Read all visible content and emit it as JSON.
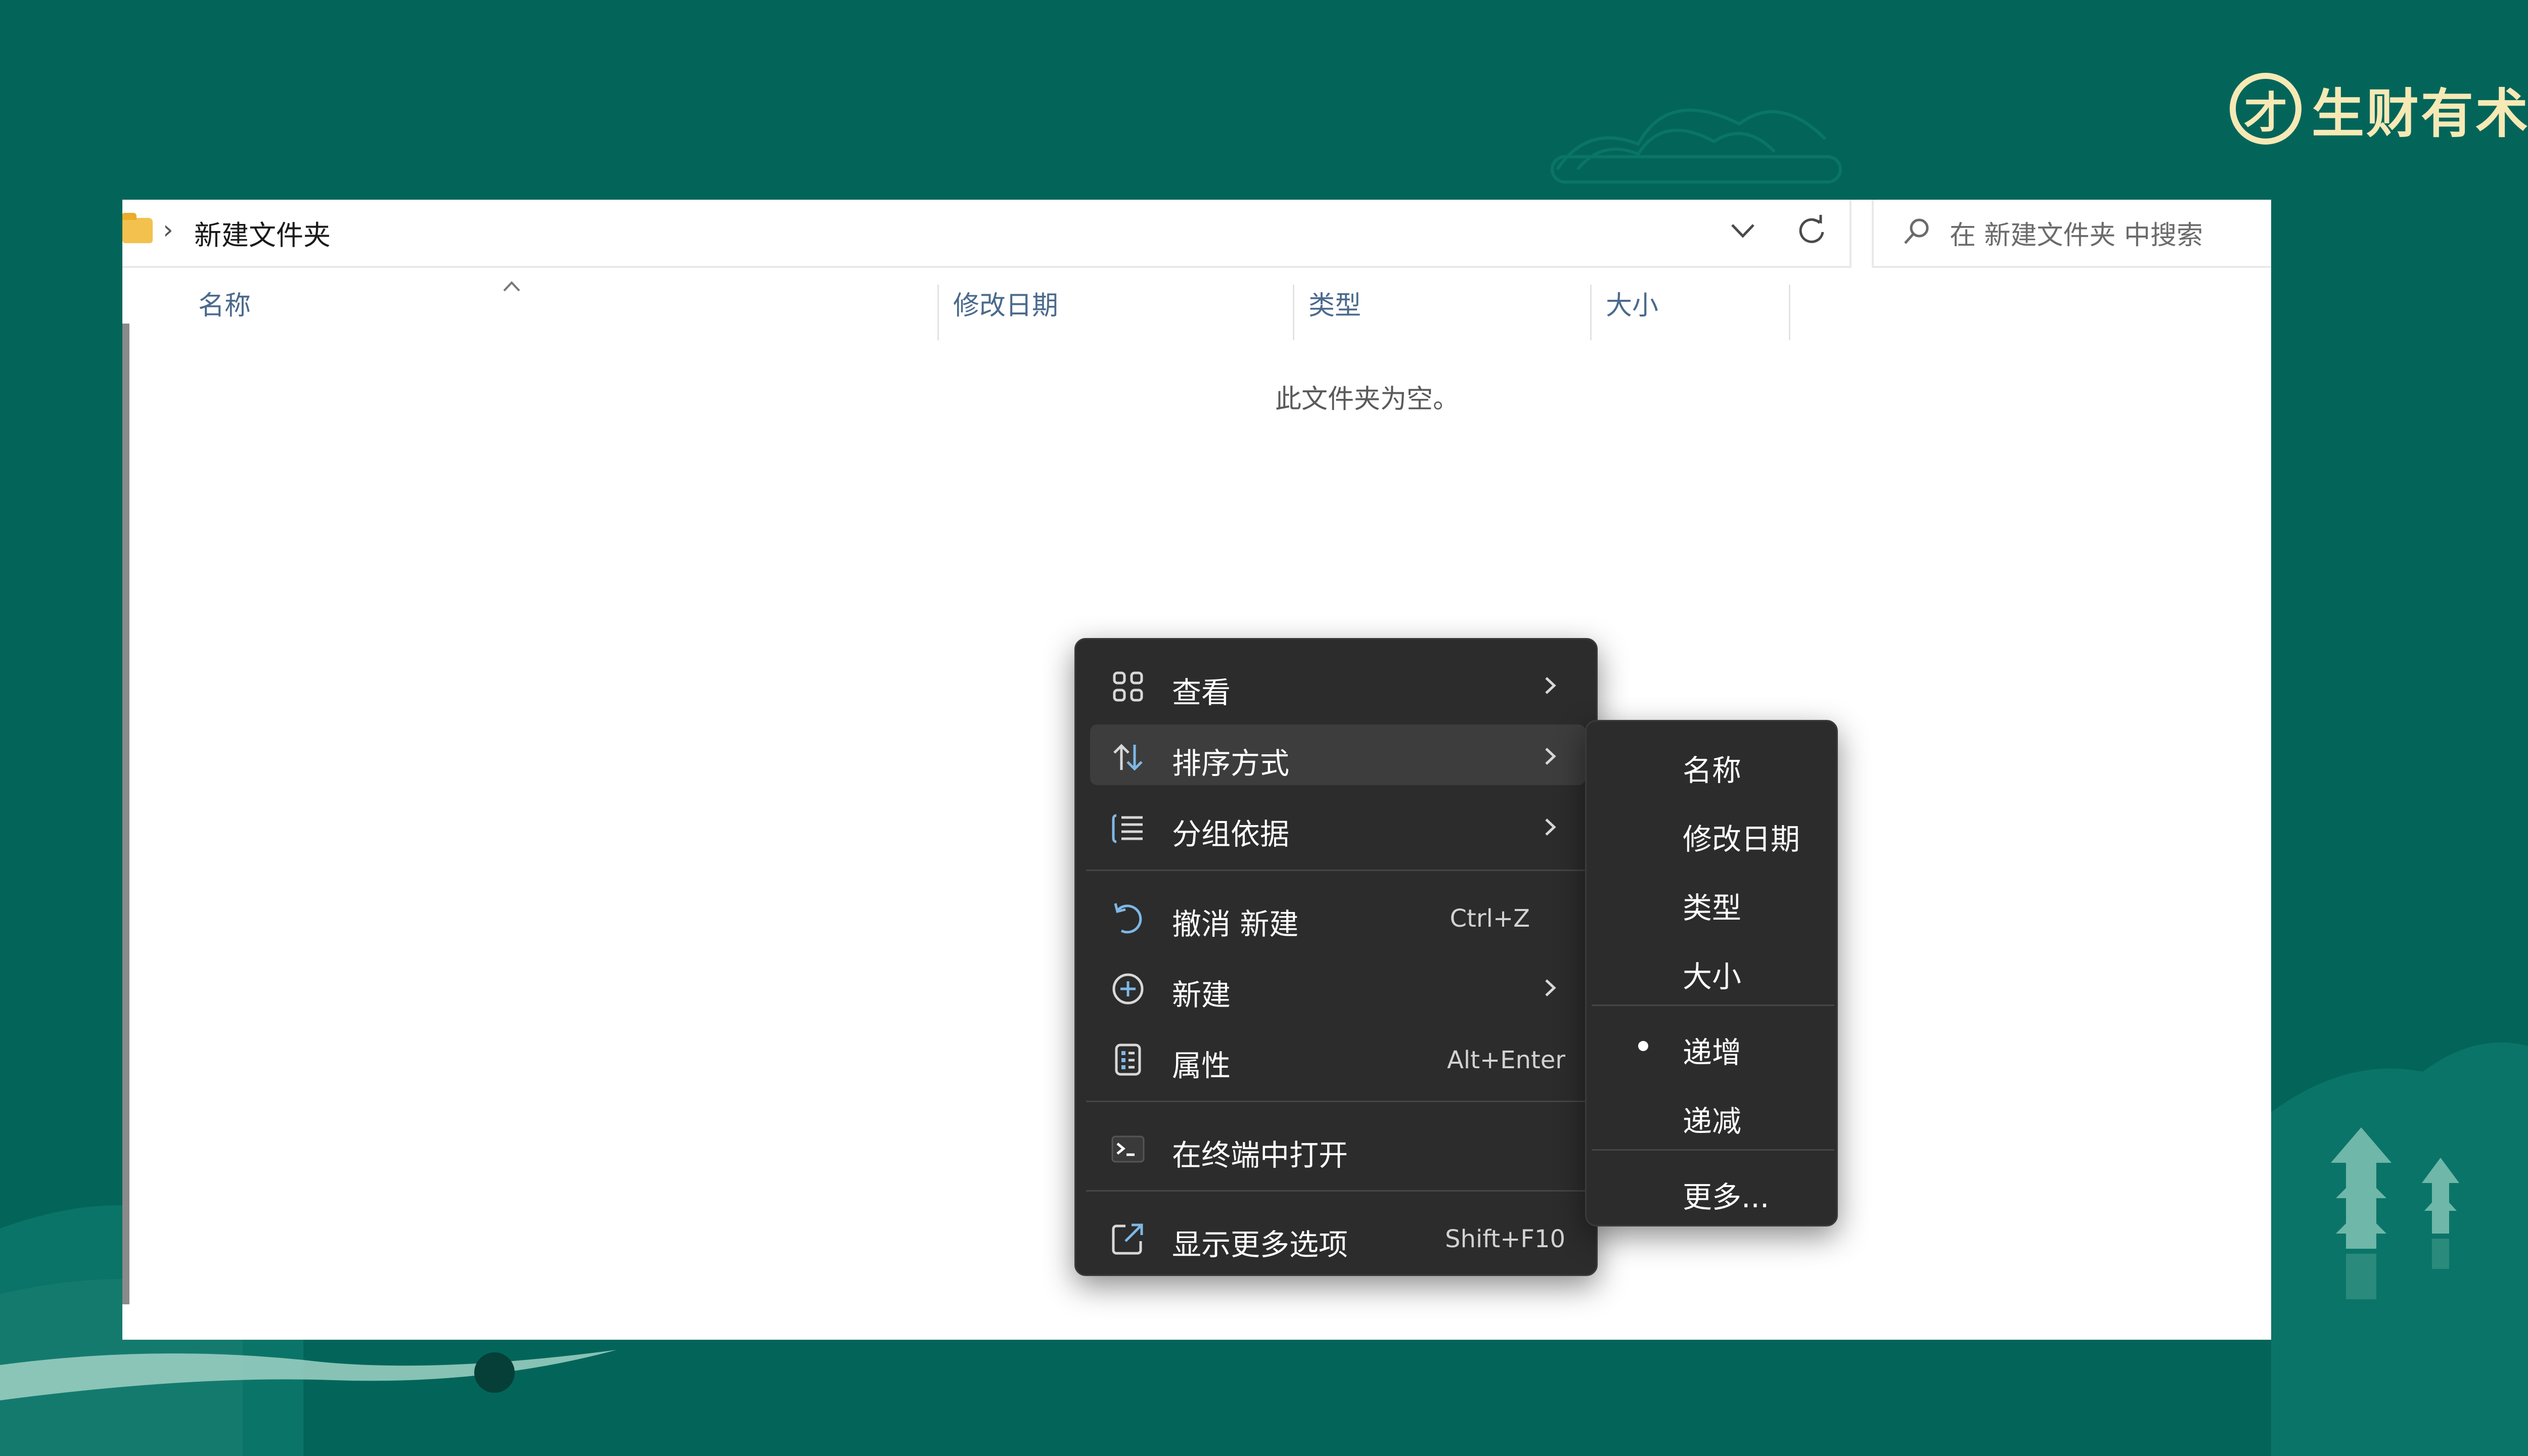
{
  "brand": {
    "mark": "才",
    "name": "生财有术"
  },
  "window": {
    "address": {
      "separator": "›",
      "path": "新建文件夹"
    },
    "search": {
      "placeholder": "在 新建文件夹 中搜索"
    },
    "columns": [
      "名称",
      "修改日期",
      "类型",
      "大小"
    ],
    "empty_message": "此文件夹为空。"
  },
  "context_menu": {
    "items": [
      {
        "label": "查看",
        "shortcut": "",
        "has_submenu": true,
        "icon": "grid-icon"
      },
      {
        "label": "排序方式",
        "shortcut": "",
        "has_submenu": true,
        "icon": "sort-icon",
        "highlighted": true
      },
      {
        "label": "分组依据",
        "shortcut": "",
        "has_submenu": true,
        "icon": "group-list-icon"
      },
      {
        "label": "撤消 新建",
        "shortcut": "Ctrl+Z",
        "has_submenu": false,
        "icon": "undo-icon"
      },
      {
        "label": "新建",
        "shortcut": "",
        "has_submenu": true,
        "icon": "plus-circle-icon"
      },
      {
        "label": "属性",
        "shortcut": "Alt+Enter",
        "has_submenu": false,
        "icon": "properties-icon"
      },
      {
        "label": "在终端中打开",
        "shortcut": "",
        "has_submenu": false,
        "icon": "terminal-icon"
      },
      {
        "label": "显示更多选项",
        "shortcut": "Shift+F10",
        "has_submenu": false,
        "icon": "external-link-icon"
      }
    ]
  },
  "sort_submenu": {
    "items": [
      {
        "label": "名称",
        "selected": false
      },
      {
        "label": "修改日期",
        "selected": false
      },
      {
        "label": "类型",
        "selected": false
      },
      {
        "label": "大小",
        "selected": false
      },
      {
        "label": "递增",
        "selected": true
      },
      {
        "label": "递减",
        "selected": false
      },
      {
        "label": "更多...",
        "selected": false
      }
    ]
  },
  "colors": {
    "background": "#03655a",
    "brand": "#f6e9b5",
    "menu_bg": "#2c2c2c",
    "menu_highlight": "#3d3d3d",
    "icon_accent": "#7fb8e6"
  }
}
